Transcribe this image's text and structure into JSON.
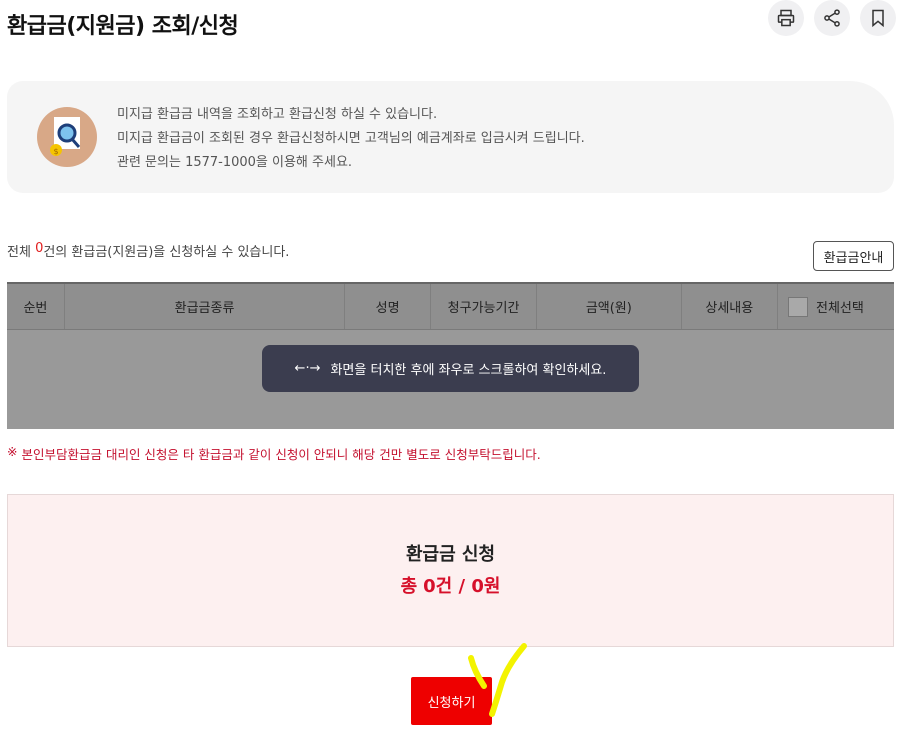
{
  "page": {
    "title": "환급금(지원금) 조회/신청"
  },
  "toolbar": {
    "icons": [
      "printer-icon",
      "share-icon",
      "bookmark-icon"
    ]
  },
  "info": {
    "lines": [
      "미지급 환급금 내역을 조회하고 환급신청 하실 수 있습니다.",
      "미지급 환급금이 조회된 경우 환급신청하시면 고객님의 예금계좌로 입금시켜 드립니다.",
      "관련 문의는 1577-1000을 이용해 주세요."
    ]
  },
  "count": {
    "prefix": "전체 ",
    "number": "0",
    "suffix": "건의 환급금(지원금)을 신청하실 수 있습니다."
  },
  "guide_button": "환급금안내",
  "table": {
    "headers": [
      "순번",
      "환급금종류",
      "성명",
      "청구가능기간",
      "금액(원)",
      "상세내용",
      "전체선택"
    ]
  },
  "toast": {
    "arrow": "←·→",
    "text": "화면을 터치한 후에 좌우로 스크롤하여 확인하세요."
  },
  "notice": {
    "mark": "※",
    "text": "본인부담환급금 대리인 신청은 타 환급금과 같이 신청이 안되니 해당 건만 별도로 신청부탁드립니다."
  },
  "summary": {
    "title": "환급금 신청",
    "total_label": "총",
    "total_value": "0건 / 0원"
  },
  "apply_button": "신청하기",
  "colors": {
    "accent": "#ee0000",
    "summary_text": "#d6102a",
    "count_number": "#e11d1d"
  }
}
